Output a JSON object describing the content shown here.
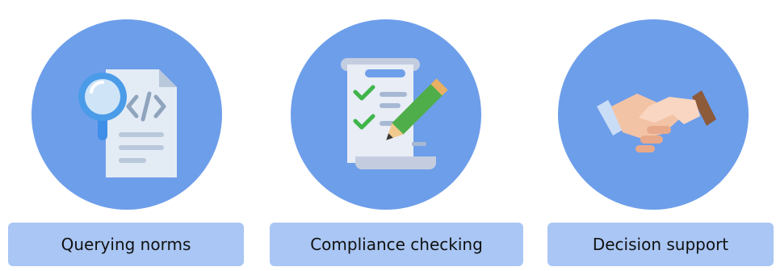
{
  "features": [
    {
      "icon": "document-search-icon",
      "label": "Querying norms"
    },
    {
      "icon": "checklist-pencil-icon",
      "label": "Compliance checking"
    },
    {
      "icon": "handshake-icon",
      "label": "Decision support"
    }
  ],
  "colors": {
    "circle": "#6d9eea",
    "label_background": "#a9c6f4",
    "text": "#111111"
  }
}
